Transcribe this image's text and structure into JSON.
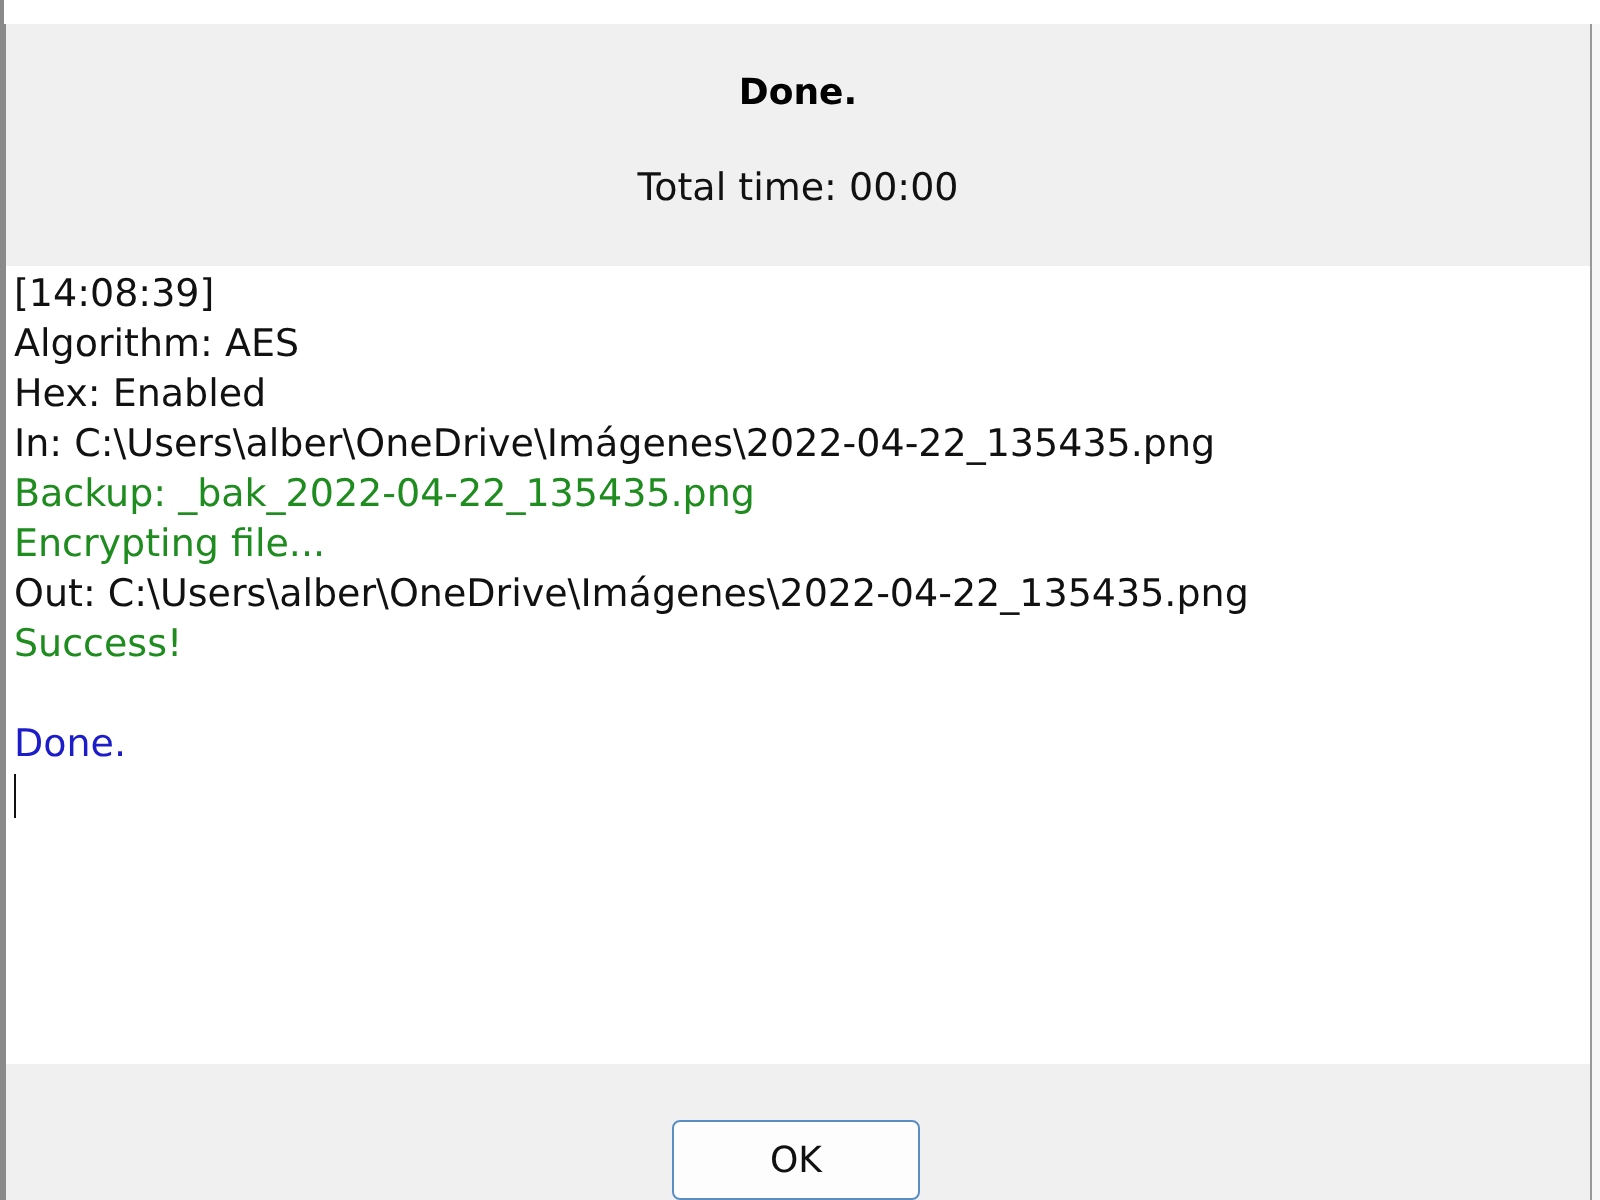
{
  "dialog": {
    "title": "Done.",
    "subtitle": "Total time: 00:00"
  },
  "log": {
    "lines": [
      {
        "kind": "normal",
        "text": "[14:08:39]"
      },
      {
        "kind": "normal",
        "text": "Algorithm: AES"
      },
      {
        "kind": "normal",
        "text": "Hex: Enabled"
      },
      {
        "kind": "normal",
        "text": "In: C:\\Users\\alber\\OneDrive\\Imágenes\\2022-04-22_135435.png"
      },
      {
        "kind": "success",
        "text": "Backup: _bak_2022-04-22_135435.png"
      },
      {
        "kind": "success",
        "text": "Encrypting file..."
      },
      {
        "kind": "normal",
        "text": "Out: C:\\Users\\alber\\OneDrive\\Imágenes\\2022-04-22_135435.png"
      },
      {
        "kind": "success",
        "text": "Success!"
      },
      {
        "kind": "blank"
      },
      {
        "kind": "info",
        "text": "Done."
      },
      {
        "kind": "caret"
      }
    ]
  },
  "buttons": [
    "OK"
  ]
}
